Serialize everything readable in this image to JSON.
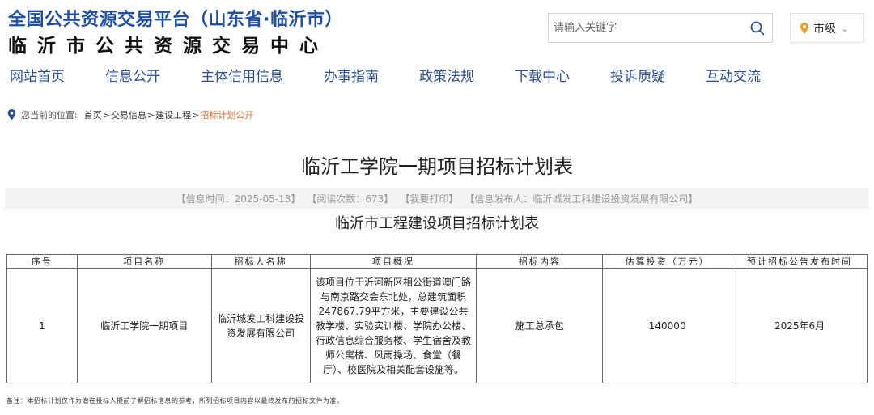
{
  "header": {
    "title": "全国公共资源交易平台（山东省·临沂市）",
    "subtitle": "临沂市公共资源交易中心"
  },
  "search": {
    "placeholder": "请输入关键字",
    "icon": "search-icon"
  },
  "region": {
    "label": "市级",
    "icon": "location-pin-icon",
    "accent": "#f0a020"
  },
  "nav": {
    "items": [
      {
        "label": "网站首页"
      },
      {
        "label": "信息公开"
      },
      {
        "label": "主体信用信息"
      },
      {
        "label": "办事指南"
      },
      {
        "label": "政策法规"
      },
      {
        "label": "下载中心"
      },
      {
        "label": "投诉质疑"
      },
      {
        "label": "互动交流"
      }
    ]
  },
  "breadcrumb": {
    "prefix": "您当前的位置:",
    "items": [
      {
        "label": "首页"
      },
      {
        "label": "交易信息"
      },
      {
        "label": "建设工程"
      }
    ],
    "current": "招标计划公开",
    "separator": ">"
  },
  "article": {
    "title": "临沂工学院一期项目招标计划表",
    "meta": {
      "time": "【信息时间：2025-05-13】",
      "reads": "【阅读次数：673】",
      "print": "【我要打印】",
      "publisher": "【信息发布人：临沂城发工科建设投资发展有限公司】"
    },
    "table_title": "临沂市工程建设项目招标计划表"
  },
  "table": {
    "headers": [
      "序号",
      "项目名称",
      "招标人名称",
      "项目概况",
      "招标内容",
      "估算投资（万元）",
      "预计招标公告发布时间"
    ],
    "rows": [
      {
        "no": "1",
        "name": "临沂工学院一期项目",
        "tenderer": "临沂城发工科建设投资发展有限公司",
        "overview": "该项目位于沂河新区相公街道澳门路与南京路交会东北处，总建筑面积247867.79平方米，主要建设公共教学楼、实验实训楼、学院办公楼、行政信息综合服务楼、学生宿舍及教师公寓楼、风雨操场、食堂（餐厅）、校医院及相关配套设施等。",
        "content": "施工总承包",
        "investment": "140000",
        "publish_time": "2025年6月"
      }
    ]
  },
  "footnote": "备注：本招标计划仅作为潜在投标人提前了解招标信息的参考，所列招标项目内容以最终发布的招标文件为准。",
  "colors": {
    "brand_blue": "#1f4fa3",
    "nav_blue": "#2a4e8f",
    "breadcrumb_current": "#e06d2c"
  }
}
